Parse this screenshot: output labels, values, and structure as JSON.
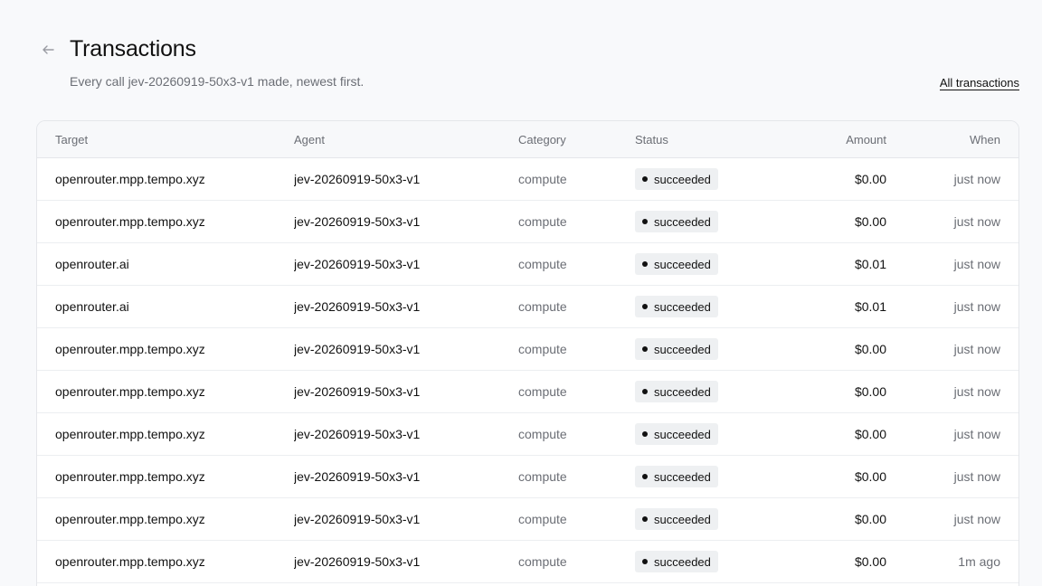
{
  "page": {
    "title": "Transactions",
    "subtitle": "Every call jev-20260919-50x3-v1 made, newest first.",
    "all_link": "All transactions",
    "back_icon": "arrow-left-icon"
  },
  "table": {
    "columns": [
      "Target",
      "Agent",
      "Category",
      "Status",
      "Amount",
      "When"
    ],
    "rows": [
      {
        "target": "openrouter.mpp.tempo.xyz",
        "agent": "jev-20260919-50x3-v1",
        "category": "compute",
        "status": "succeeded",
        "amount": "$0.00",
        "when": "just now"
      },
      {
        "target": "openrouter.mpp.tempo.xyz",
        "agent": "jev-20260919-50x3-v1",
        "category": "compute",
        "status": "succeeded",
        "amount": "$0.00",
        "when": "just now"
      },
      {
        "target": "openrouter.ai",
        "agent": "jev-20260919-50x3-v1",
        "category": "compute",
        "status": "succeeded",
        "amount": "$0.01",
        "when": "just now"
      },
      {
        "target": "openrouter.ai",
        "agent": "jev-20260919-50x3-v1",
        "category": "compute",
        "status": "succeeded",
        "amount": "$0.01",
        "when": "just now"
      },
      {
        "target": "openrouter.mpp.tempo.xyz",
        "agent": "jev-20260919-50x3-v1",
        "category": "compute",
        "status": "succeeded",
        "amount": "$0.00",
        "when": "just now"
      },
      {
        "target": "openrouter.mpp.tempo.xyz",
        "agent": "jev-20260919-50x3-v1",
        "category": "compute",
        "status": "succeeded",
        "amount": "$0.00",
        "when": "just now"
      },
      {
        "target": "openrouter.mpp.tempo.xyz",
        "agent": "jev-20260919-50x3-v1",
        "category": "compute",
        "status": "succeeded",
        "amount": "$0.00",
        "when": "just now"
      },
      {
        "target": "openrouter.mpp.tempo.xyz",
        "agent": "jev-20260919-50x3-v1",
        "category": "compute",
        "status": "succeeded",
        "amount": "$0.00",
        "when": "just now"
      },
      {
        "target": "openrouter.mpp.tempo.xyz",
        "agent": "jev-20260919-50x3-v1",
        "category": "compute",
        "status": "succeeded",
        "amount": "$0.00",
        "when": "just now"
      },
      {
        "target": "openrouter.mpp.tempo.xyz",
        "agent": "jev-20260919-50x3-v1",
        "category": "compute",
        "status": "succeeded",
        "amount": "$0.00",
        "when": "1m ago"
      }
    ]
  }
}
